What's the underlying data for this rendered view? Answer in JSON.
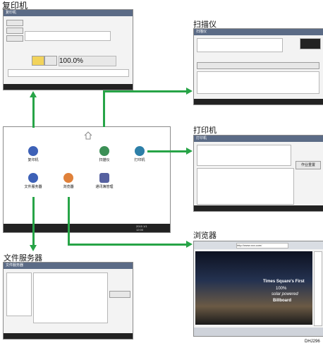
{
  "labels": {
    "copier": "复印机",
    "scanner": "扫描仪",
    "printer": "打印机",
    "document_server": "文件服务器",
    "browser": "浏览器",
    "figure_code": "DHJ296"
  },
  "home_screen": {
    "apps": [
      {
        "label": "复印机",
        "icon": "copier-icon",
        "color": "#3d61b7"
      },
      {
        "label": "扫描仪",
        "icon": "scanner-icon",
        "color": "#3b8f55"
      },
      {
        "label": "打印机",
        "icon": "printer-icon",
        "color": "#2d7fa8"
      },
      {
        "label": "文件服务器",
        "icon": "document-server-icon",
        "color": "#3d61b7"
      },
      {
        "label": "浏览器",
        "icon": "browser-icon",
        "color": "#e0813a"
      },
      {
        "label": "通讯簿管理",
        "icon": "address-book-icon",
        "color": "#5661a0"
      }
    ],
    "time": "2015 1/1",
    "status": "12:00"
  },
  "copier_screen": {
    "title": "复印机",
    "ratio": "100.0%"
  },
  "scanner_screen": {
    "title": "扫描仪"
  },
  "printer_screen": {
    "title": "打印机",
    "action": "作业重置"
  },
  "docserver_screen": {
    "title": "文件服务器"
  },
  "browser_screen": {
    "url": "http://www.xxx.com/",
    "headline": "Times Square's First",
    "line2": "100%",
    "line3": "solar powered",
    "line4": "Billboard"
  }
}
